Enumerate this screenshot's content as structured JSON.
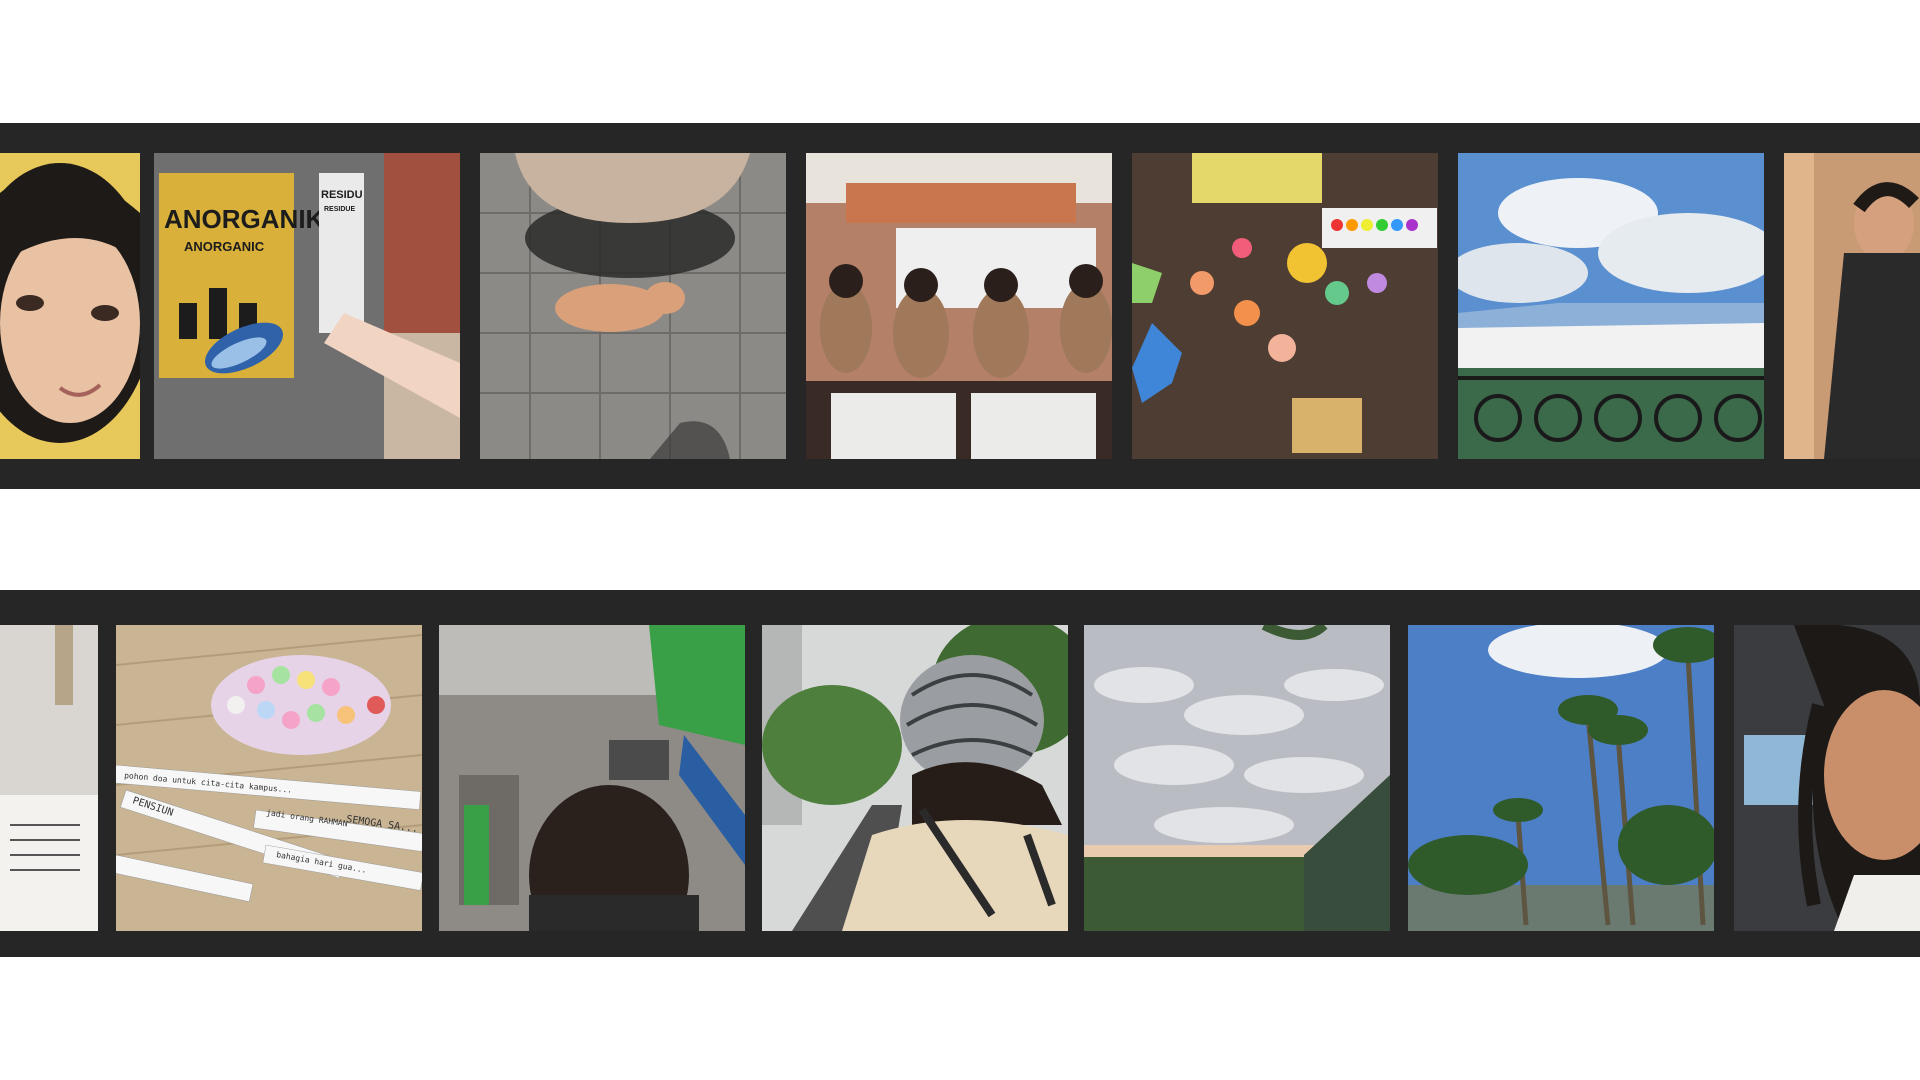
{
  "frames": {
    "bin": {
      "sign_main": "ANORGANIK",
      "sign_sub": "ANORGANIC",
      "sign_right": "RESIDU",
      "sign_right_sub": "RESIDUE"
    },
    "paper_strips": {
      "line1": "pohon doa untuk cita-cita kampus...",
      "line2": "PENSIUN",
      "line3": "SEMOGA SA...",
      "line4": "jadi orang RAHMAN",
      "line5": "bahagia hari gua..."
    }
  },
  "colors": {
    "background": "#ffffff",
    "film": "#262626",
    "bin_yellow": "#d8b03a",
    "sky_blue": "#5a8fd0"
  }
}
